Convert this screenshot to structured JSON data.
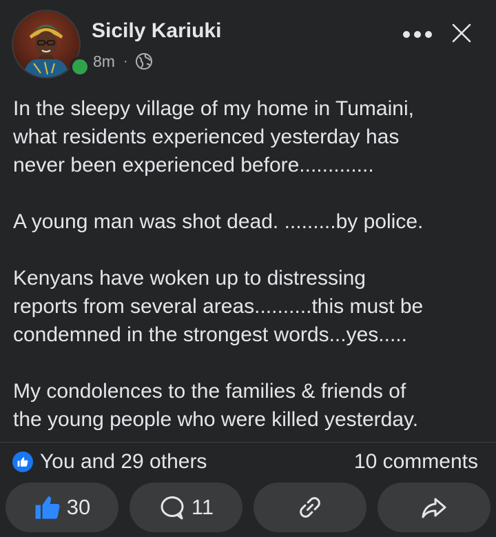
{
  "post": {
    "author": "Sicily Kariuki",
    "time": "8m",
    "separator": "·",
    "audience_icon": "globe-icon",
    "menu_icon": "more-dots-icon",
    "close_icon": "close-icon",
    "paragraphs": [
      "In the sleepy village of my home in Tumaini,\nwhat residents experienced yesterday has\nnever been experienced before.............",
      "A young man was shot dead. .........by police.",
      "Kenyans have woken up to distressing\nreports from several areas..........this must be\ncondemned in the strongest words...yes.....",
      "My condolences to the families & friends of\nthe young people who were killed yesterday."
    ]
  },
  "reactions": {
    "summary": "You and 29 others",
    "comments": "10 comments",
    "badge_icon": "like-icon"
  },
  "actions": {
    "like": {
      "icon": "thumbs-up-icon",
      "count": "30"
    },
    "comment": {
      "icon": "comment-bubble-icon",
      "count": "11"
    },
    "link": {
      "icon": "link-icon"
    },
    "share": {
      "icon": "share-arrow-icon"
    }
  },
  "colors": {
    "background": "#242526",
    "text": "#e4e6eb",
    "secondary_text": "#b0b3b8",
    "accent_blue": "#1877f2",
    "online_green": "#31a24c",
    "pill_background": "#3a3b3c"
  }
}
